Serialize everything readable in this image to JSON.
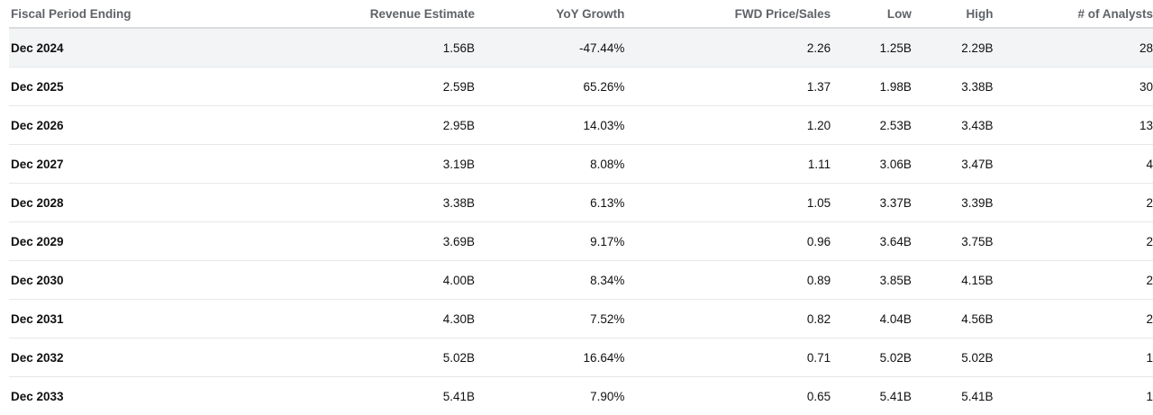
{
  "headers": [
    "Fiscal Period Ending",
    "Revenue Estimate",
    "YoY Growth",
    "FWD Price/Sales",
    "Low",
    "High",
    "# of Analysts"
  ],
  "rows": [
    [
      "Dec 2024",
      "1.56B",
      "-47.44%",
      "2.26",
      "1.25B",
      "2.29B",
      "28"
    ],
    [
      "Dec 2025",
      "2.59B",
      "65.26%",
      "1.37",
      "1.98B",
      "3.38B",
      "30"
    ],
    [
      "Dec 2026",
      "2.95B",
      "14.03%",
      "1.20",
      "2.53B",
      "3.43B",
      "13"
    ],
    [
      "Dec 2027",
      "3.19B",
      "8.08%",
      "1.11",
      "3.06B",
      "3.47B",
      "4"
    ],
    [
      "Dec 2028",
      "3.38B",
      "6.13%",
      "1.05",
      "3.37B",
      "3.39B",
      "2"
    ],
    [
      "Dec 2029",
      "3.69B",
      "9.17%",
      "0.96",
      "3.64B",
      "3.75B",
      "2"
    ],
    [
      "Dec 2030",
      "4.00B",
      "8.34%",
      "0.89",
      "3.85B",
      "4.15B",
      "2"
    ],
    [
      "Dec 2031",
      "4.30B",
      "7.52%",
      "0.82",
      "4.04B",
      "4.56B",
      "2"
    ],
    [
      "Dec 2032",
      "5.02B",
      "16.64%",
      "0.71",
      "5.02B",
      "5.02B",
      "1"
    ],
    [
      "Dec 2033",
      "5.41B",
      "7.90%",
      "0.65",
      "5.41B",
      "5.41B",
      "1"
    ]
  ]
}
